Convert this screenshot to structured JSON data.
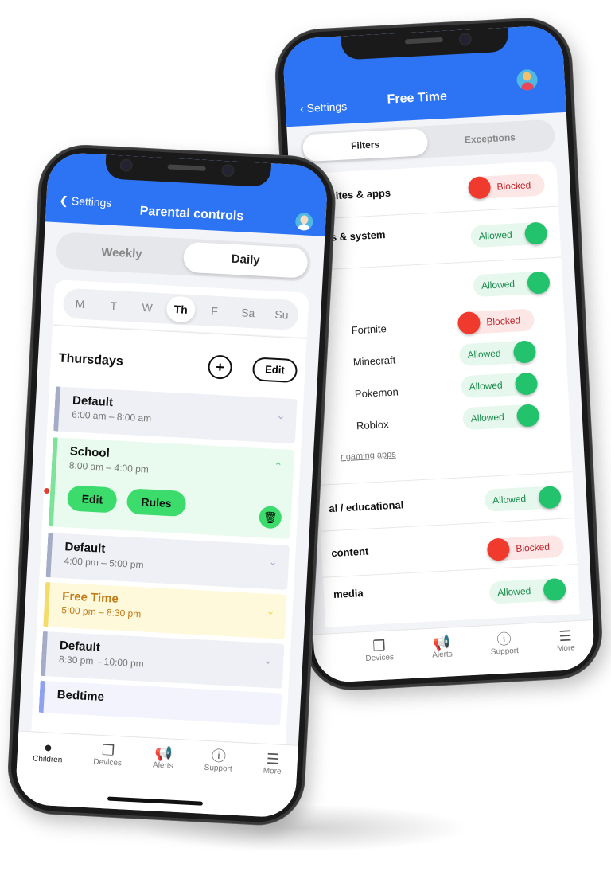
{
  "left_phone": {
    "header": {
      "back_label": "Settings",
      "title": "Parental controls",
      "avatar": "child-avatar-icon"
    },
    "mode_toggle": {
      "options": [
        "Weekly",
        "Daily"
      ],
      "selected": "Daily"
    },
    "days": {
      "items": [
        "M",
        "T",
        "W",
        "Th",
        "F",
        "Sa",
        "Su"
      ],
      "selected": "Th"
    },
    "schedule": {
      "heading": "Thursdays",
      "add_icon": "plus-icon",
      "edit_label": "Edit",
      "blocks": [
        {
          "name": "Default",
          "time": "6:00 am – 8:00 am",
          "chevron": "chevron-down-icon"
        },
        {
          "name": "School",
          "time": "8:00 am – 4:00 pm",
          "chevron": "chevron-up-icon",
          "expanded": true,
          "edit_label": "Edit",
          "rules_label": "Rules",
          "delete_icon": "trash-icon"
        },
        {
          "name": "Default",
          "time": "4:00 pm – 5:00 pm",
          "chevron": "chevron-down-icon"
        },
        {
          "name": "Free Time",
          "time": "5:00 pm – 8:30 pm",
          "chevron": "chevron-down-icon"
        },
        {
          "name": "Default",
          "time": "8:30 pm – 10:00 pm",
          "chevron": "chevron-down-icon"
        },
        {
          "name": "Bedtime",
          "time": ""
        }
      ]
    },
    "tabbar": {
      "items": [
        {
          "label": "Children",
          "icon": "children-icon",
          "active": true
        },
        {
          "label": "Devices",
          "icon": "devices-icon"
        },
        {
          "label": "Alerts",
          "icon": "megaphone-icon"
        },
        {
          "label": "Support",
          "icon": "help-circle-icon"
        },
        {
          "label": "More",
          "icon": "menu-icon"
        }
      ]
    },
    "colors": {
      "header": "#2d74f5",
      "accent_green": "#3bdb6c",
      "free_time": "#c07a16"
    }
  },
  "right_phone": {
    "header": {
      "back_label": "Settings",
      "title": "Free Time",
      "avatar": "child-avatar-icon"
    },
    "tabs": {
      "options": [
        "Filters",
        "Exceptions"
      ],
      "selected": "Filters"
    },
    "filters": [
      {
        "label": "wn sites & apps",
        "state": "Blocked"
      },
      {
        "label": "ores & system",
        "label2": "s",
        "state": "Allowed"
      },
      {
        "label": "",
        "state": "Allowed"
      },
      {
        "label": "Fortnite",
        "state": "Blocked",
        "sub": true
      },
      {
        "label": "Minecraft",
        "state": "Allowed",
        "sub": true
      },
      {
        "label": "Pokemon",
        "state": "Allowed",
        "sub": true
      },
      {
        "label": "Roblox",
        "state": "Allowed",
        "sub": true
      },
      {
        "label": "al / educational",
        "state": "Allowed"
      },
      {
        "label": "content",
        "state": "Blocked"
      },
      {
        "label": "media",
        "state": "Allowed"
      }
    ],
    "gaming_link": "r gaming apps",
    "tabbar": {
      "items": [
        {
          "label": "Devices",
          "icon": "devices-icon"
        },
        {
          "label": "Alerts",
          "icon": "megaphone-icon"
        },
        {
          "label": "Support",
          "icon": "help-circle-icon"
        },
        {
          "label": "More",
          "icon": "menu-icon"
        }
      ]
    },
    "colors": {
      "allowed": "#23c26c",
      "blocked": "#f03a2e"
    }
  }
}
